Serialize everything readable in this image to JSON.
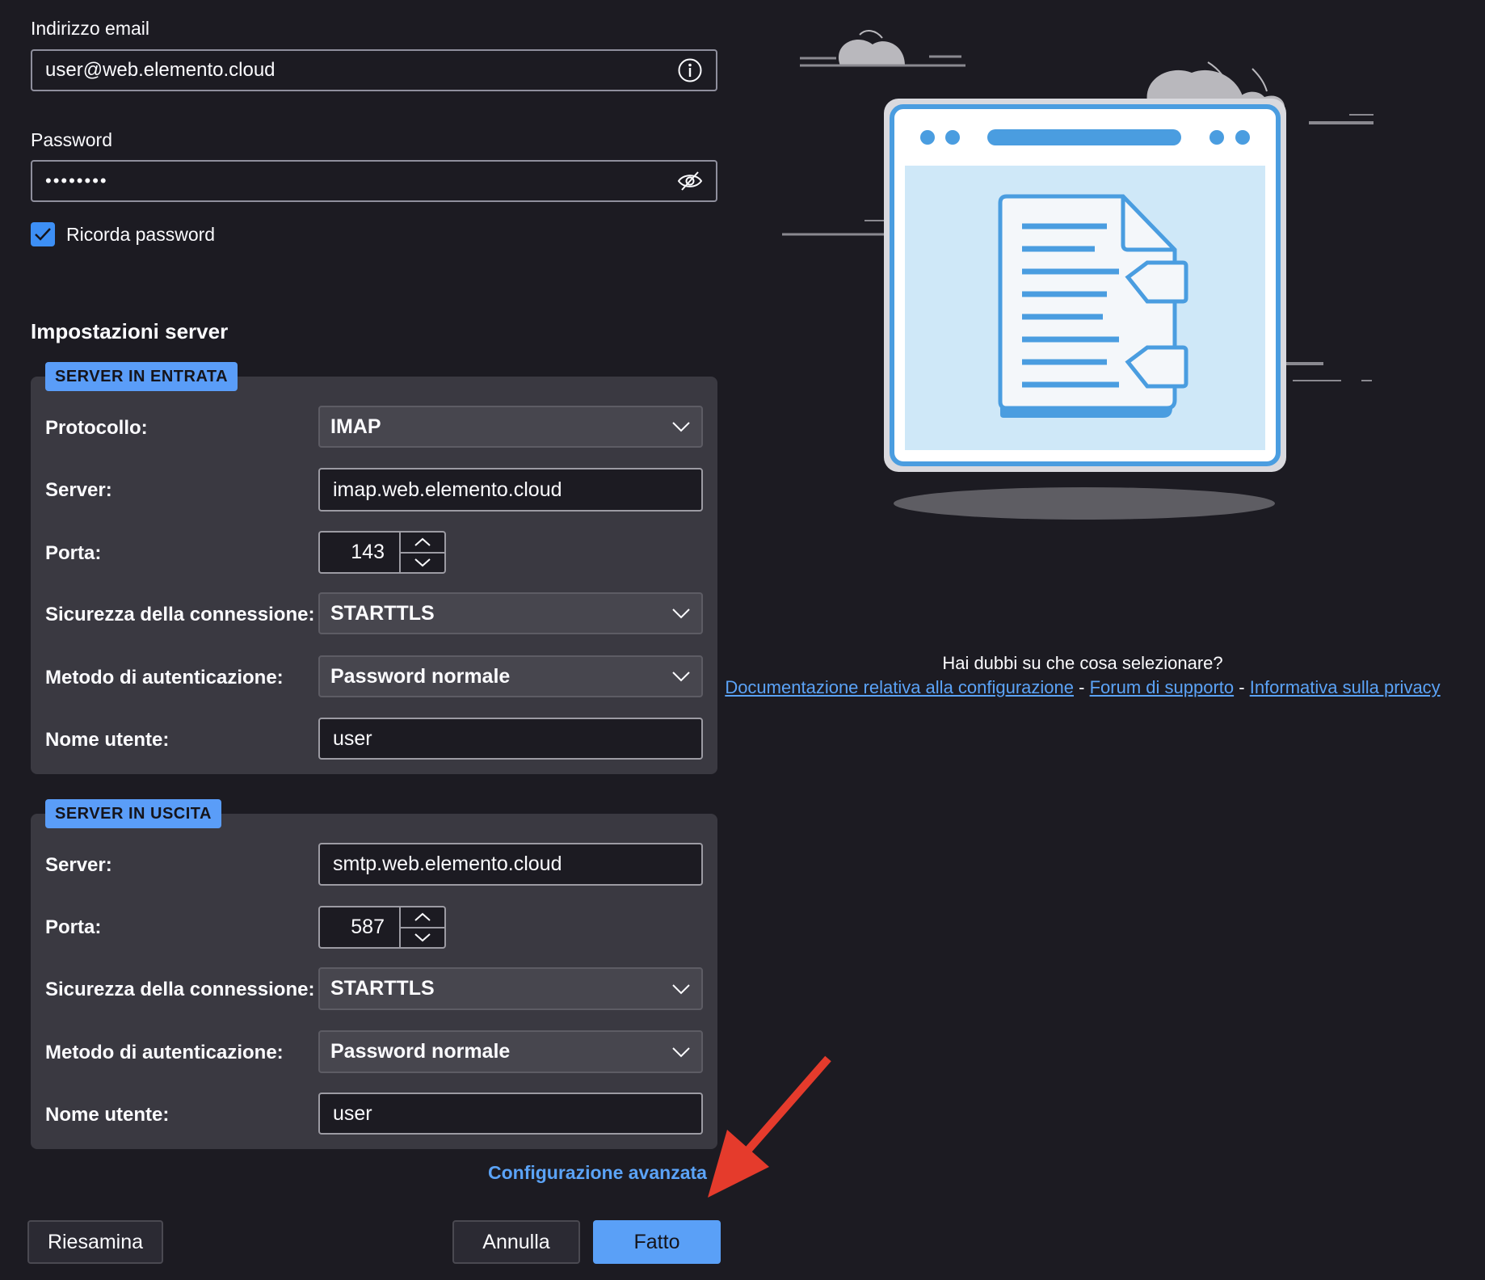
{
  "account": {
    "email_label": "Indirizzo email",
    "email_value": "user@web.elemento.cloud",
    "password_label": "Password",
    "password_value": "••••••••",
    "remember_label": "Ricorda password",
    "remember_checked": true
  },
  "server_settings": {
    "title": "Impostazioni server",
    "incoming": {
      "legend": "SERVER IN ENTRATA",
      "protocol_label": "Protocollo:",
      "protocol_value": "IMAP",
      "server_label": "Server:",
      "server_value": "imap.web.elemento.cloud",
      "port_label": "Porta:",
      "port_value": "143",
      "security_label": "Sicurezza della connessione:",
      "security_value": "STARTTLS",
      "auth_label": "Metodo di autenticazione:",
      "auth_value": "Password normale",
      "username_label": "Nome utente:",
      "username_value": "user"
    },
    "outgoing": {
      "legend": "SERVER IN USCITA",
      "server_label": "Server:",
      "server_value": "smtp.web.elemento.cloud",
      "port_label": "Porta:",
      "port_value": "587",
      "security_label": "Sicurezza della connessione:",
      "security_value": "STARTTLS",
      "auth_label": "Metodo di autenticazione:",
      "auth_value": "Password normale",
      "username_label": "Nome utente:",
      "username_value": "user"
    },
    "advanced_link": "Configurazione avanzata"
  },
  "help": {
    "question": "Hai dubbi su che cosa selezionare?",
    "link_docs": "Documentazione relativa alla configurazione",
    "separator": "-",
    "link_forum": "Forum di supporto",
    "link_privacy": "Informativa sulla privacy"
  },
  "buttons": {
    "review": "Riesamina",
    "cancel": "Annulla",
    "done": "Fatto"
  },
  "colors": {
    "background": "#1c1b22",
    "accent": "#5aa0f7",
    "panel": "#3a3941",
    "annotation_arrow": "#e53b2c"
  }
}
